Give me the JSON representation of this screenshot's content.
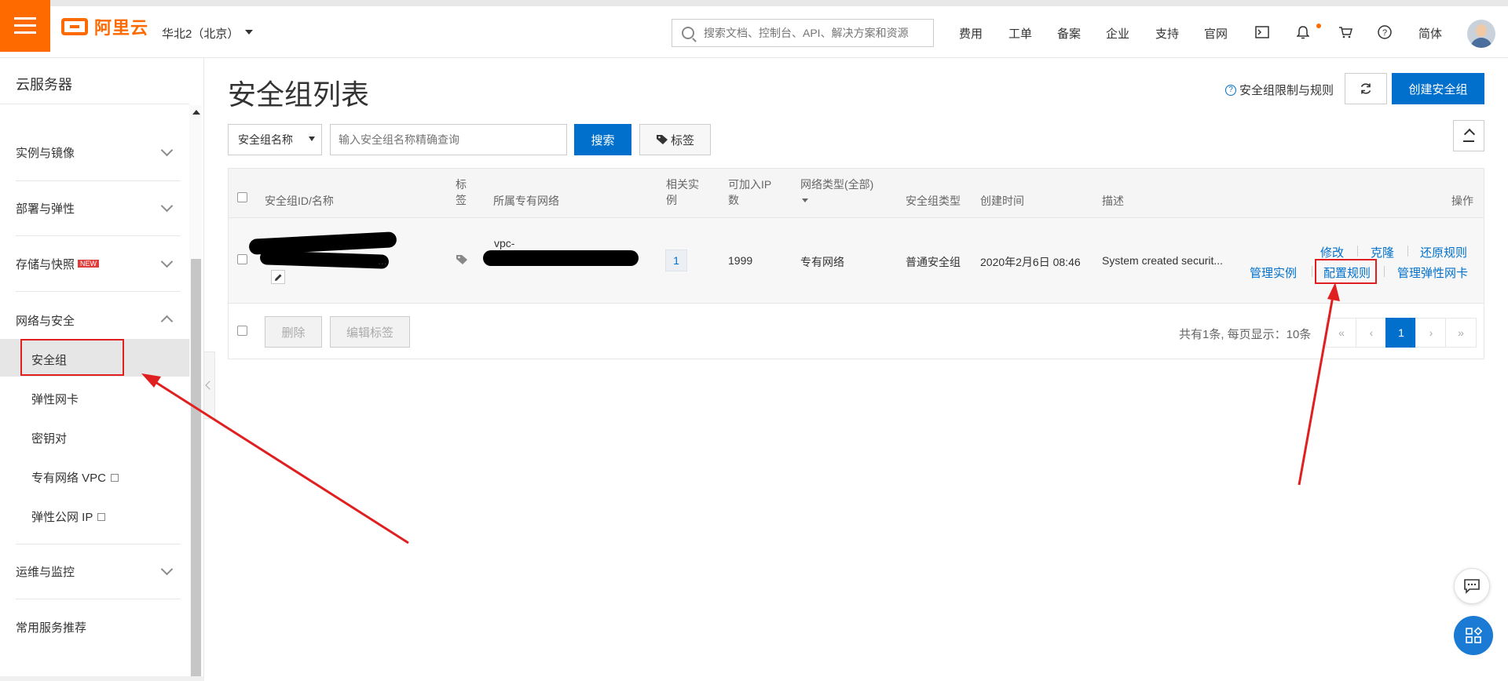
{
  "topbar": {
    "brand": "阿里云",
    "region": "华北2（北京）",
    "search_placeholder": "搜索文档、控制台、API、解决方案和资源",
    "nav": [
      "费用",
      "工单",
      "备案",
      "企业",
      "支持",
      "官网"
    ],
    "icons": [
      "terminal-icon",
      "bell-icon",
      "cart-icon",
      "help-icon"
    ],
    "language": "简体"
  },
  "sidebar": {
    "title": "云服务器",
    "groups": [
      {
        "label": "实例与镜像",
        "expanded": false
      },
      {
        "label": "部署与弹性",
        "expanded": false
      },
      {
        "label": "存储与快照",
        "badge": "NEW",
        "expanded": false
      },
      {
        "label": "网络与安全",
        "expanded": true
      },
      {
        "label": "运维与监控",
        "expanded": false
      },
      {
        "label": "常用服务推荐",
        "expanded": false
      }
    ],
    "network_items": [
      {
        "label": "安全组",
        "active": true
      },
      {
        "label": "弹性网卡"
      },
      {
        "label": "密钥对"
      },
      {
        "label": "专有网络 VPC",
        "external": true
      },
      {
        "label": "弹性公网 IP",
        "external": true
      }
    ]
  },
  "main": {
    "title": "安全组列表",
    "help_link": "安全组限制与规则",
    "create_label": "创建安全组",
    "filter": {
      "select_value": "安全组名称",
      "input_placeholder": "输入安全组名称精确查询",
      "search_label": "搜索",
      "tags_label": "标签"
    },
    "table": {
      "headers": {
        "id_name": "安全组ID/名称",
        "tag_1": "标",
        "tag_2": "签",
        "vpc": "所属专有网络",
        "related_1": "相关实",
        "related_2": "例",
        "available_1": "可加入IP",
        "available_2": "数",
        "network_type": "网络类型(全部)",
        "sg_type": "安全组类型",
        "created": "创建时间",
        "desc": "描述",
        "ops": "操作"
      },
      "rows": [
        {
          "name_fragment": "...",
          "vpc_prefix": "vpc-",
          "related": "1",
          "available_ip": "1999",
          "network_type": "专有网络",
          "sg_type": "普通安全组",
          "created": "2020年2月6日 08:46",
          "desc": "System created securit...",
          "ops": {
            "modify": "修改",
            "clone": "克隆",
            "restore": "还原规则",
            "manage_instances": "管理实例",
            "configure_rules": "配置规则",
            "manage_eni": "管理弹性网卡"
          }
        }
      ]
    },
    "footer": {
      "delete_label": "删除",
      "edit_tags_label": "编辑标签",
      "pager_info": "共有1条, 每页显示：10条",
      "pages": [
        "«",
        "‹",
        "1",
        "›",
        "»"
      ],
      "current_page": "1"
    }
  },
  "colors": {
    "brand_orange": "#ff6a00",
    "primary_blue": "#0070cc",
    "annotation_red": "#e02020"
  }
}
